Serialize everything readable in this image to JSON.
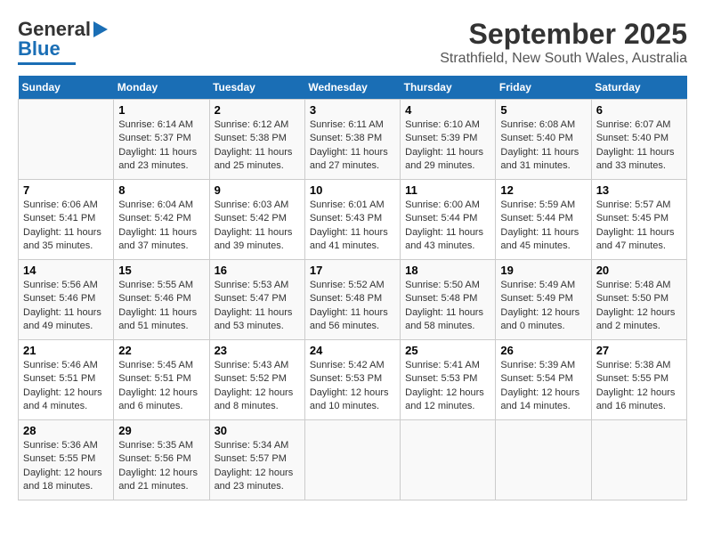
{
  "header": {
    "logo_general": "General",
    "logo_blue": "Blue",
    "title": "September 2025",
    "subtitle": "Strathfield, New South Wales, Australia"
  },
  "days_of_week": [
    "Sunday",
    "Monday",
    "Tuesday",
    "Wednesday",
    "Thursday",
    "Friday",
    "Saturday"
  ],
  "weeks": [
    [
      {
        "day": "",
        "content": ""
      },
      {
        "day": "1",
        "content": "Sunrise: 6:14 AM\nSunset: 5:37 PM\nDaylight: 11 hours\nand 23 minutes."
      },
      {
        "day": "2",
        "content": "Sunrise: 6:12 AM\nSunset: 5:38 PM\nDaylight: 11 hours\nand 25 minutes."
      },
      {
        "day": "3",
        "content": "Sunrise: 6:11 AM\nSunset: 5:38 PM\nDaylight: 11 hours\nand 27 minutes."
      },
      {
        "day": "4",
        "content": "Sunrise: 6:10 AM\nSunset: 5:39 PM\nDaylight: 11 hours\nand 29 minutes."
      },
      {
        "day": "5",
        "content": "Sunrise: 6:08 AM\nSunset: 5:40 PM\nDaylight: 11 hours\nand 31 minutes."
      },
      {
        "day": "6",
        "content": "Sunrise: 6:07 AM\nSunset: 5:40 PM\nDaylight: 11 hours\nand 33 minutes."
      }
    ],
    [
      {
        "day": "7",
        "content": "Sunrise: 6:06 AM\nSunset: 5:41 PM\nDaylight: 11 hours\nand 35 minutes."
      },
      {
        "day": "8",
        "content": "Sunrise: 6:04 AM\nSunset: 5:42 PM\nDaylight: 11 hours\nand 37 minutes."
      },
      {
        "day": "9",
        "content": "Sunrise: 6:03 AM\nSunset: 5:42 PM\nDaylight: 11 hours\nand 39 minutes."
      },
      {
        "day": "10",
        "content": "Sunrise: 6:01 AM\nSunset: 5:43 PM\nDaylight: 11 hours\nand 41 minutes."
      },
      {
        "day": "11",
        "content": "Sunrise: 6:00 AM\nSunset: 5:44 PM\nDaylight: 11 hours\nand 43 minutes."
      },
      {
        "day": "12",
        "content": "Sunrise: 5:59 AM\nSunset: 5:44 PM\nDaylight: 11 hours\nand 45 minutes."
      },
      {
        "day": "13",
        "content": "Sunrise: 5:57 AM\nSunset: 5:45 PM\nDaylight: 11 hours\nand 47 minutes."
      }
    ],
    [
      {
        "day": "14",
        "content": "Sunrise: 5:56 AM\nSunset: 5:46 PM\nDaylight: 11 hours\nand 49 minutes."
      },
      {
        "day": "15",
        "content": "Sunrise: 5:55 AM\nSunset: 5:46 PM\nDaylight: 11 hours\nand 51 minutes."
      },
      {
        "day": "16",
        "content": "Sunrise: 5:53 AM\nSunset: 5:47 PM\nDaylight: 11 hours\nand 53 minutes."
      },
      {
        "day": "17",
        "content": "Sunrise: 5:52 AM\nSunset: 5:48 PM\nDaylight: 11 hours\nand 56 minutes."
      },
      {
        "day": "18",
        "content": "Sunrise: 5:50 AM\nSunset: 5:48 PM\nDaylight: 11 hours\nand 58 minutes."
      },
      {
        "day": "19",
        "content": "Sunrise: 5:49 AM\nSunset: 5:49 PM\nDaylight: 12 hours\nand 0 minutes."
      },
      {
        "day": "20",
        "content": "Sunrise: 5:48 AM\nSunset: 5:50 PM\nDaylight: 12 hours\nand 2 minutes."
      }
    ],
    [
      {
        "day": "21",
        "content": "Sunrise: 5:46 AM\nSunset: 5:51 PM\nDaylight: 12 hours\nand 4 minutes."
      },
      {
        "day": "22",
        "content": "Sunrise: 5:45 AM\nSunset: 5:51 PM\nDaylight: 12 hours\nand 6 minutes."
      },
      {
        "day": "23",
        "content": "Sunrise: 5:43 AM\nSunset: 5:52 PM\nDaylight: 12 hours\nand 8 minutes."
      },
      {
        "day": "24",
        "content": "Sunrise: 5:42 AM\nSunset: 5:53 PM\nDaylight: 12 hours\nand 10 minutes."
      },
      {
        "day": "25",
        "content": "Sunrise: 5:41 AM\nSunset: 5:53 PM\nDaylight: 12 hours\nand 12 minutes."
      },
      {
        "day": "26",
        "content": "Sunrise: 5:39 AM\nSunset: 5:54 PM\nDaylight: 12 hours\nand 14 minutes."
      },
      {
        "day": "27",
        "content": "Sunrise: 5:38 AM\nSunset: 5:55 PM\nDaylight: 12 hours\nand 16 minutes."
      }
    ],
    [
      {
        "day": "28",
        "content": "Sunrise: 5:36 AM\nSunset: 5:55 PM\nDaylight: 12 hours\nand 18 minutes."
      },
      {
        "day": "29",
        "content": "Sunrise: 5:35 AM\nSunset: 5:56 PM\nDaylight: 12 hours\nand 21 minutes."
      },
      {
        "day": "30",
        "content": "Sunrise: 5:34 AM\nSunset: 5:57 PM\nDaylight: 12 hours\nand 23 minutes."
      },
      {
        "day": "",
        "content": ""
      },
      {
        "day": "",
        "content": ""
      },
      {
        "day": "",
        "content": ""
      },
      {
        "day": "",
        "content": ""
      }
    ]
  ]
}
